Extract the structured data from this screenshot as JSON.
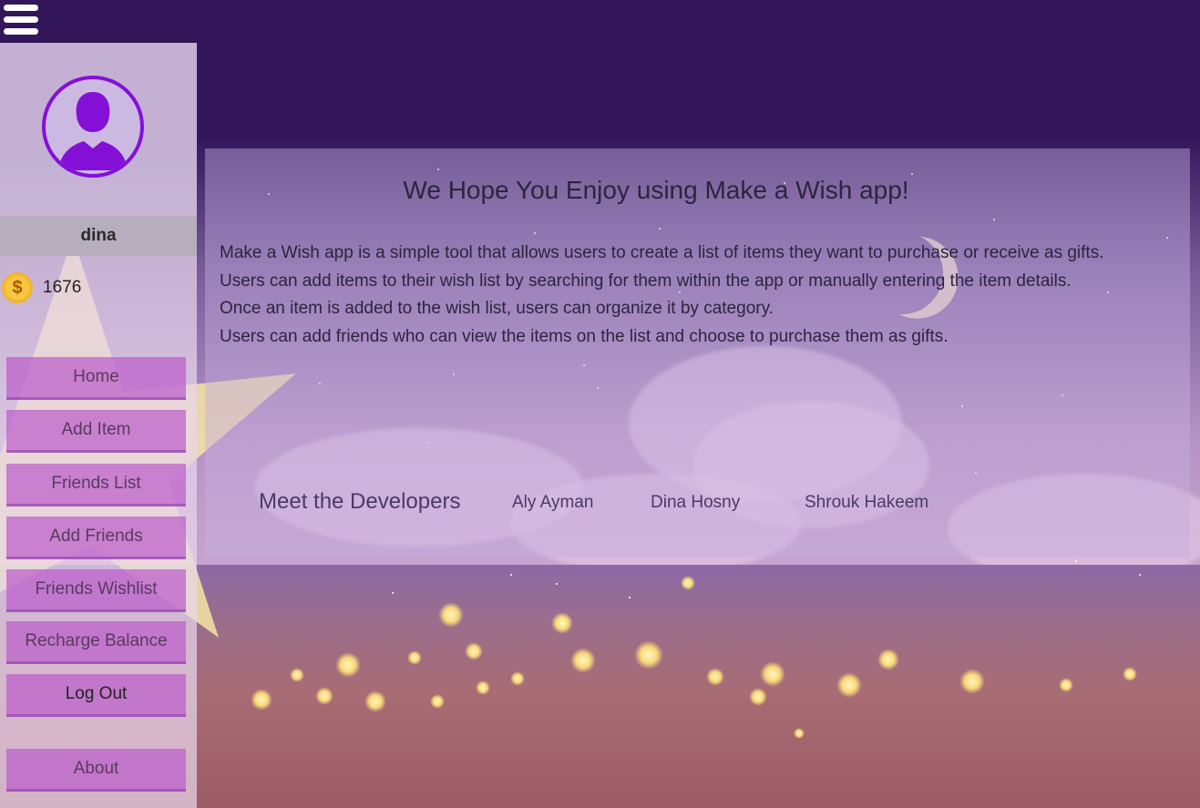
{
  "sidebar": {
    "username": "dina",
    "balance": "1676",
    "nav": [
      "Home",
      "Add Item",
      "Friends List",
      "Add Friends",
      "Friends Wishlist",
      "Recharge Balance",
      "Log Out"
    ],
    "about": "About"
  },
  "main": {
    "title": "We Hope You Enjoy using Make a Wish app!",
    "description": [
      "Make a Wish app is a simple tool that allows users to create a list of items they want to purchase or receive as gifts.",
      "Users can add items to their wish list by searching for them within the app or manually entering the item details.",
      "Once an item is added to the wish list, users can organize it by category.",
      "Users can add friends who can view the items on the list and choose to purchase them as gifts."
    ],
    "developers_heading": "Meet the Developers",
    "developers": [
      "Aly Ayman",
      "Dina Hosny",
      "Shrouk Hakeem"
    ]
  },
  "icons": {
    "menu": "hamburger-icon",
    "avatar": "user-silhouette-icon",
    "coin": "coin-icon"
  },
  "colors": {
    "accent": "#8410d8",
    "nav_button": "#bb5ecb",
    "header": "#33165a"
  }
}
